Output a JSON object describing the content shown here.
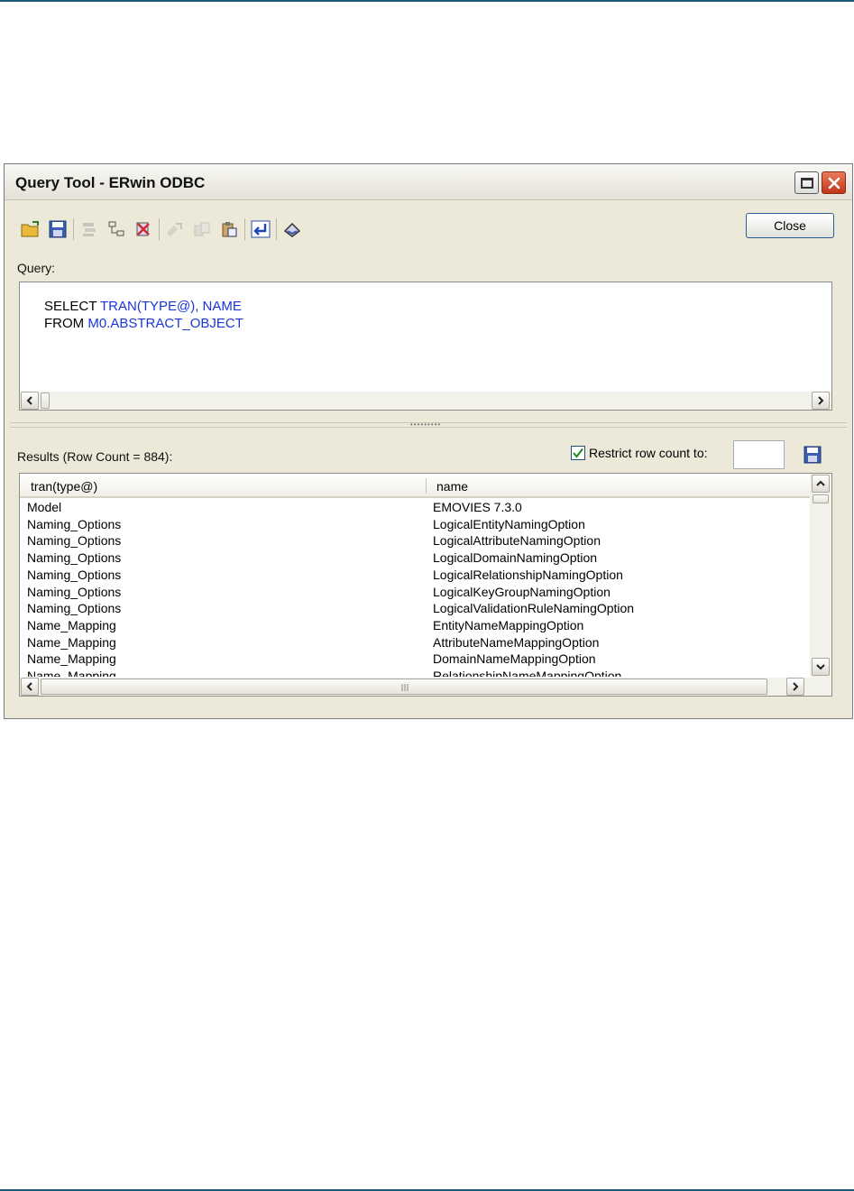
{
  "window": {
    "title": "Query Tool - ERwin ODBC"
  },
  "toolbar": {
    "icons": [
      "open-folder-icon",
      "save-icon",
      "cut-icon",
      "copy-icon",
      "delete-icon",
      "paste-icon",
      "copy-disabled-icon",
      "paste-special-icon",
      "execute-icon",
      "clear-icon"
    ],
    "close_label": "Close"
  },
  "query": {
    "label": "Query:",
    "lines": [
      {
        "keyword": "SELECT ",
        "rest": "TRAN(TYPE@), NAME"
      },
      {
        "keyword": "FROM ",
        "rest": "M0.ABSTRACT_OBJECT"
      }
    ]
  },
  "results": {
    "label": "Results (Row Count = 884):",
    "restrict_label": "Restrict row count to:",
    "restrict_checked": true,
    "restrict_value": "",
    "columns": [
      "tran(type@)",
      "name"
    ],
    "rows": [
      [
        "Model",
        "EMOVIES 7.3.0"
      ],
      [
        "Naming_Options",
        "LogicalEntityNamingOption"
      ],
      [
        "Naming_Options",
        "LogicalAttributeNamingOption"
      ],
      [
        "Naming_Options",
        "LogicalDomainNamingOption"
      ],
      [
        "Naming_Options",
        "LogicalRelationshipNamingOption"
      ],
      [
        "Naming_Options",
        "LogicalKeyGroupNamingOption"
      ],
      [
        "Naming_Options",
        "LogicalValidationRuleNamingOption"
      ],
      [
        "Name_Mapping",
        "EntityNameMappingOption"
      ],
      [
        "Name_Mapping",
        "AttributeNameMappingOption"
      ],
      [
        "Name_Mapping",
        "DomainNameMappingOption"
      ],
      [
        "Name_Mapping",
        "RelationshipNameMappingOption"
      ]
    ]
  }
}
